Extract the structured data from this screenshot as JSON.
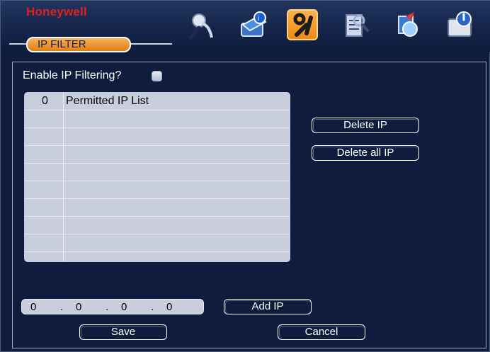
{
  "app": {
    "brand": "Honeywell",
    "active_tab": "IP FILTER"
  },
  "toolbar": {
    "icons": [
      {
        "name": "search-icon"
      },
      {
        "name": "info-icon"
      },
      {
        "name": "tools-icon",
        "active": true
      },
      {
        "name": "settings-list-icon"
      },
      {
        "name": "backup-icon"
      },
      {
        "name": "shutdown-icon"
      }
    ]
  },
  "filter": {
    "enable_label": "Enable IP Filtering?",
    "enabled": false
  },
  "list": {
    "count": "0",
    "header": "Permitted IP List",
    "rows": [
      "",
      "",
      "",
      "",
      "",
      "",
      "",
      "",
      ""
    ]
  },
  "buttons": {
    "delete_ip": "Delete IP",
    "delete_all_ip": "Delete all IP",
    "add_ip": "Add IP",
    "save": "Save",
    "cancel": "Cancel"
  },
  "ip_input": {
    "octet1": "0",
    "octet2": "0",
    "octet3": "0",
    "octet4": "0",
    "sep": "."
  },
  "colors": {
    "brand": "#e0201e",
    "tab_active": "#f08a16",
    "background": "#0f1c3d"
  }
}
